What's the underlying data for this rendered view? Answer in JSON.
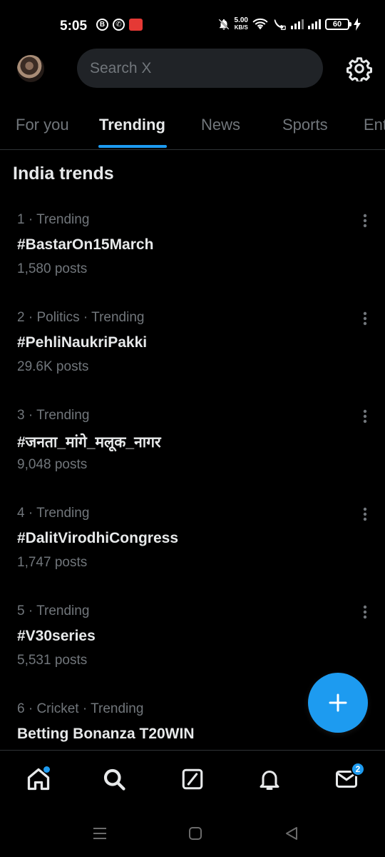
{
  "status_bar": {
    "time": "5:05",
    "speed_value": "5.00",
    "speed_unit": "KB/S",
    "battery": "60",
    "left_icons": [
      "b-circle-icon",
      "whatsapp-icon",
      "record-icon"
    ],
    "right_icons": [
      "bell-off-icon",
      "wifi-icon",
      "wifi-calling-icon",
      "signal-icon",
      "signal-icon",
      "battery-icon",
      "charging-icon"
    ]
  },
  "header": {
    "search_placeholder": "Search X",
    "settings_icon": "gear-icon"
  },
  "tabs": [
    {
      "label": "For you",
      "active": false
    },
    {
      "label": "Trending",
      "active": true
    },
    {
      "label": "News",
      "active": false
    },
    {
      "label": "Sports",
      "active": false
    },
    {
      "label": "Ent",
      "active": false
    }
  ],
  "section": {
    "title": "India trends"
  },
  "trends": [
    {
      "meta": "1 · Trending",
      "name": "#BastarOn15March",
      "count": "1,580 posts"
    },
    {
      "meta": "2 · Politics · Trending",
      "name": "#PehliNaukriPakki",
      "count": "29.6K posts"
    },
    {
      "meta": "3 · Trending",
      "name": "#जनता_मांगे_मलूक_नागर",
      "count": "9,048 posts"
    },
    {
      "meta": "4 · Trending",
      "name": "#DalitVirodhiCongress",
      "count": "1,747 posts"
    },
    {
      "meta": "5 · Trending",
      "name": "#V30series",
      "count": "5,531 posts"
    },
    {
      "meta": "6 · Cricket · Trending",
      "name": "Betting Bonanza T20WIN",
      "count": ""
    }
  ],
  "bottom_nav": {
    "items": [
      "home-icon",
      "search-icon",
      "grok-icon",
      "notifications-icon",
      "messages-icon"
    ],
    "messages_badge": "2"
  },
  "colors": {
    "accent": "#1d9bf0",
    "background": "#000000",
    "text_primary": "#e7e9ea",
    "text_secondary": "#71767b"
  }
}
